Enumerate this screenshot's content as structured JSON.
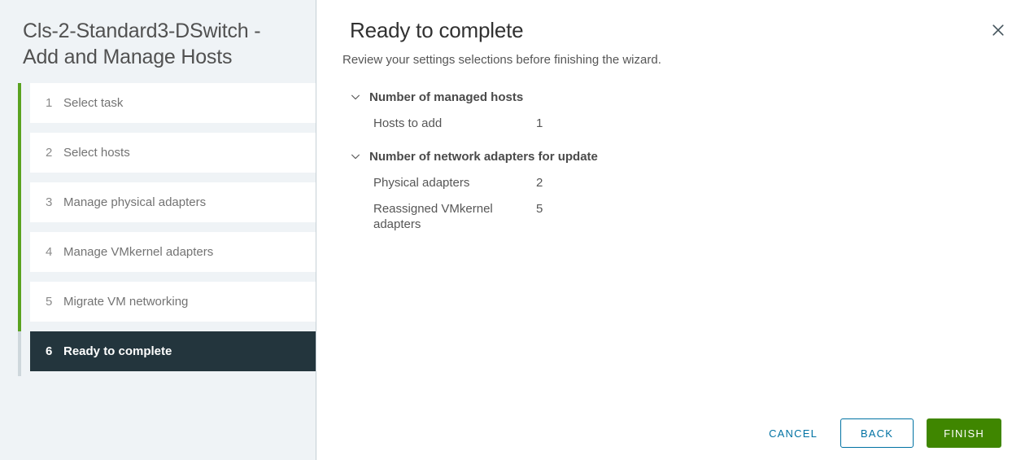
{
  "wizard": {
    "title": "Cls-2-Standard3-DSwitch - Add and Manage Hosts",
    "close_icon": "close-icon"
  },
  "sidebar": {
    "steps": [
      {
        "num": "1",
        "label": "Select task",
        "active": false
      },
      {
        "num": "2",
        "label": "Select hosts",
        "active": false
      },
      {
        "num": "3",
        "label": "Manage physical adapters",
        "active": false
      },
      {
        "num": "4",
        "label": "Manage VMkernel adapters",
        "active": false
      },
      {
        "num": "5",
        "label": "Migrate VM networking",
        "active": false
      },
      {
        "num": "6",
        "label": "Ready to complete",
        "active": true
      }
    ]
  },
  "main": {
    "title": "Ready to complete",
    "subtitle": "Review your settings selections before finishing the wizard.",
    "sections": [
      {
        "title": "Number of managed hosts",
        "icon": "chevron-down-icon",
        "expanded": true,
        "rows": [
          {
            "label": "Hosts to add",
            "value": "1"
          }
        ]
      },
      {
        "title": "Number of network adapters for update",
        "icon": "chevron-down-icon",
        "expanded": true,
        "rows": [
          {
            "label": "Physical adapters",
            "value": "2"
          },
          {
            "label": "Reassigned VMkernel adapters",
            "value": "5"
          }
        ]
      }
    ]
  },
  "footer": {
    "cancel_label": "CANCEL",
    "back_label": "BACK",
    "finish_label": "FINISH"
  },
  "colors": {
    "accent_green": "#5aa220",
    "primary_green": "#3f8600",
    "link_blue": "#0072a3",
    "active_step_bg": "#23353d",
    "sidebar_bg": "#eff3f6"
  }
}
